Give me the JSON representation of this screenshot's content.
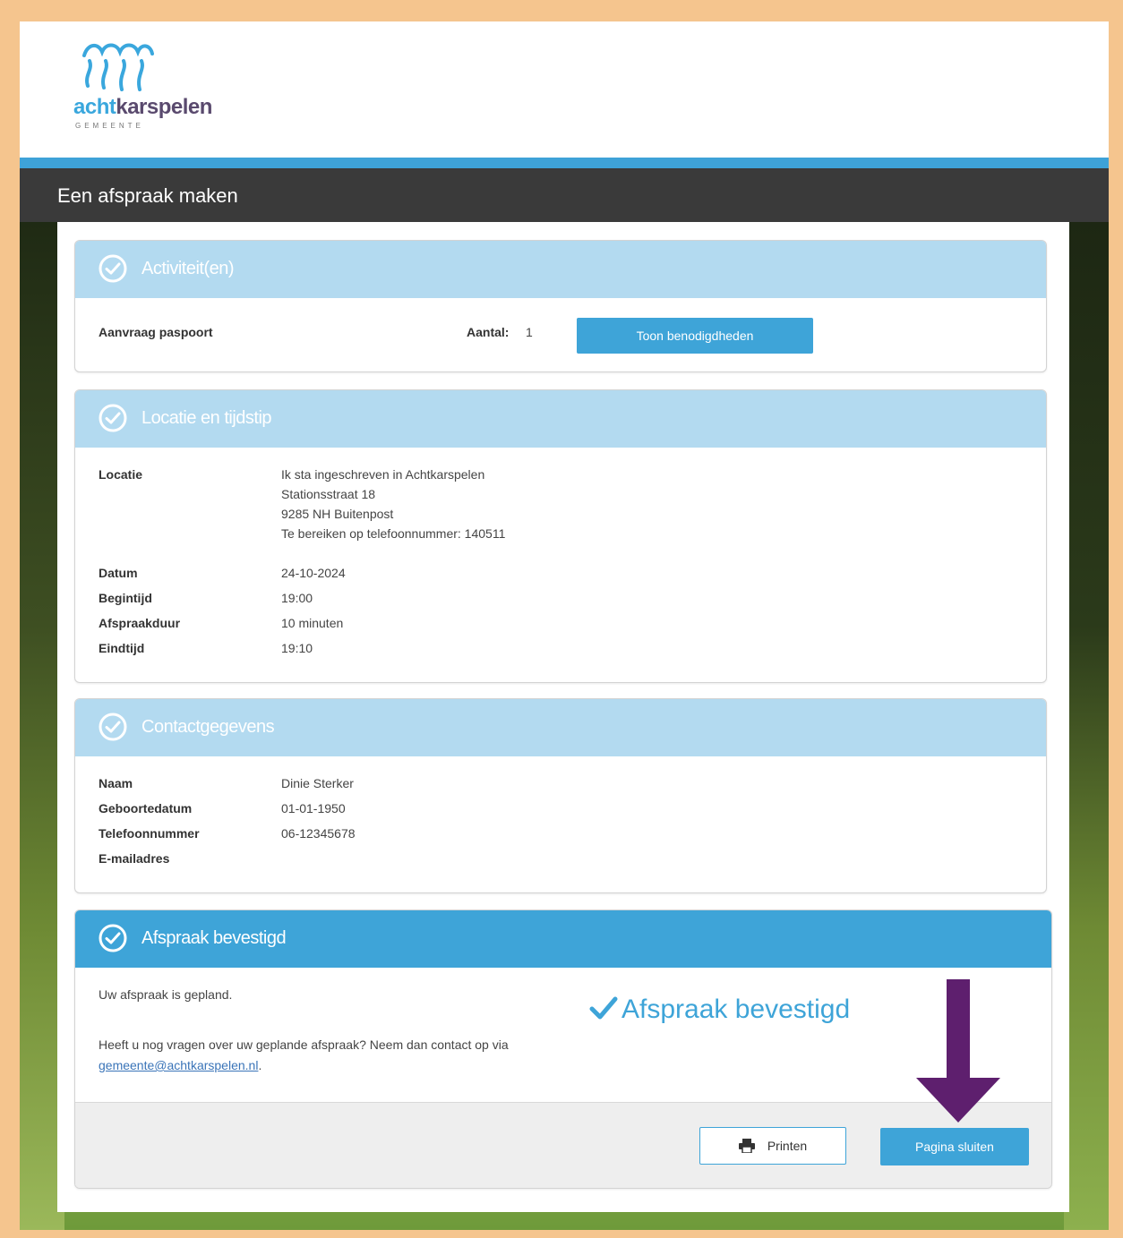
{
  "brand": {
    "logo_part1": "acht",
    "logo_part2": "karspelen",
    "logo_sub": "GEMEENTE"
  },
  "page": {
    "title": "Een afspraak maken"
  },
  "activities": {
    "heading": "Activiteit(en)",
    "item": "Aanvraag paspoort",
    "count_label": "Aantal:",
    "count_value": "1",
    "button": "Toon benodigdheden"
  },
  "location": {
    "heading": "Locatie en tijdstip",
    "location_label": "Locatie",
    "location_lines": [
      "Ik sta ingeschreven in Achtkarspelen",
      "Stationsstraat 18",
      "9285 NH Buitenpost",
      "Te bereiken op telefoonnummer: 140511"
    ],
    "date_label": "Datum",
    "date_value": "24-10-2024",
    "start_label": "Begintijd",
    "start_value": "19:00",
    "duration_label": "Afspraakduur",
    "duration_value": "10 minuten",
    "end_label": "Eindtijd",
    "end_value": "19:10"
  },
  "contact": {
    "heading": "Contactgegevens",
    "name_label": "Naam",
    "name_value": "Dinie Sterker",
    "birth_label": "Geboortedatum",
    "birth_value": "01-01-1950",
    "phone_label": "Telefoonnummer",
    "phone_value": "06-12345678",
    "email_label": "E-mailadres",
    "email_value": ""
  },
  "confirmation": {
    "heading": "Afspraak bevestigd",
    "planned_text": "Uw afspraak is gepland.",
    "question_text": "Heeft u nog vragen over uw geplande afspraak? Neem dan contact op via",
    "email_link": "gemeente@achtkarspelen.nl",
    "email_suffix": ".",
    "big_status": "Afspraak bevestigd",
    "print_button": "Printen",
    "close_button": "Pagina sluiten"
  },
  "colors": {
    "accent": "#3ea4d8",
    "panel_header_light": "#b3daf0",
    "title_bar": "#3a3a3a",
    "border_frame": "#f5c58e",
    "arrow": "#5e1f6e"
  },
  "icons": {
    "panel_check": "check-circle-icon",
    "print": "printer-icon",
    "big_check": "checkmark-icon",
    "annotation": "arrow-down-icon"
  }
}
